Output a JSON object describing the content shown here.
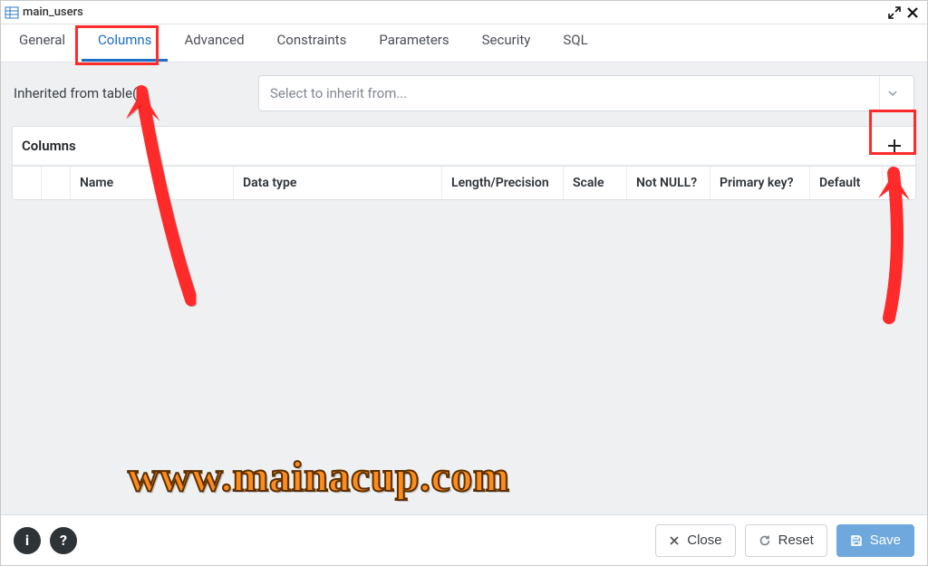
{
  "window": {
    "title": "main_users"
  },
  "tabs": {
    "general": "General",
    "columns": "Columns",
    "advanced": "Advanced",
    "constraints": "Constraints",
    "parameters": "Parameters",
    "security": "Security",
    "sql": "SQL",
    "active": "columns"
  },
  "inherit": {
    "label": "Inherited from table(s)",
    "placeholder": "Select to inherit from..."
  },
  "columns_panel": {
    "header": "Columns",
    "headers": {
      "name": "Name",
      "data_type": "Data type",
      "length": "Length/Precision",
      "scale": "Scale",
      "not_null": "Not NULL?",
      "primary_key": "Primary key?",
      "default": "Default"
    }
  },
  "footer": {
    "close": "Close",
    "reset": "Reset",
    "save": "Save"
  },
  "watermark": "www.mainacup.com"
}
